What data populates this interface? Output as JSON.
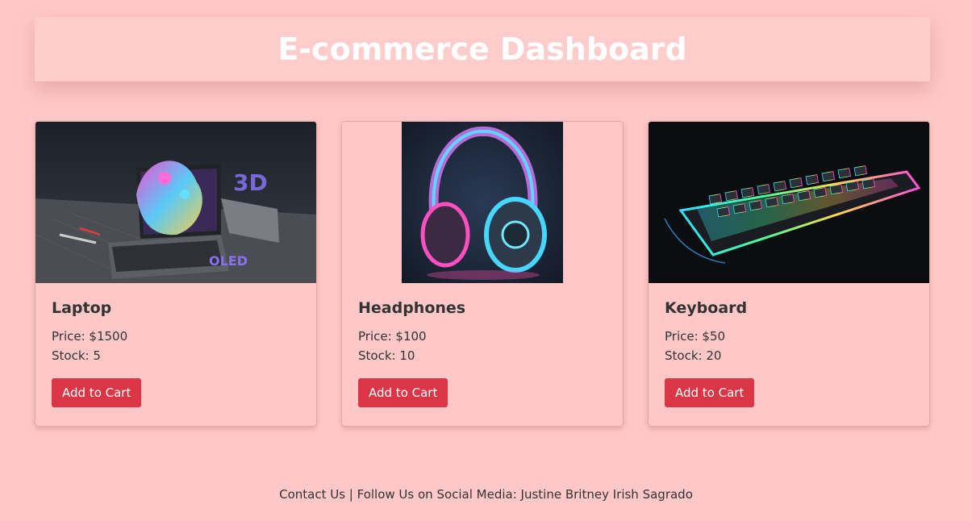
{
  "header": {
    "title": "E-commerce Dashboard"
  },
  "products": [
    {
      "name": "Laptop",
      "price_text": "Price: $1500",
      "stock_text": "Stock: 5",
      "button_label": "Add to Cart"
    },
    {
      "name": "Headphones",
      "price_text": "Price: $100",
      "stock_text": "Stock: 10",
      "button_label": "Add to Cart"
    },
    {
      "name": "Keyboard",
      "price_text": "Price: $50",
      "stock_text": "Stock: 20",
      "button_label": "Add to Cart"
    }
  ],
  "footer": {
    "text": "Contact Us | Follow Us on Social Media: Justine Britney Irish Sagrado"
  },
  "colors": {
    "background": "#ffc8c8",
    "header_title": "#ffffff",
    "button": "#dc3545"
  }
}
